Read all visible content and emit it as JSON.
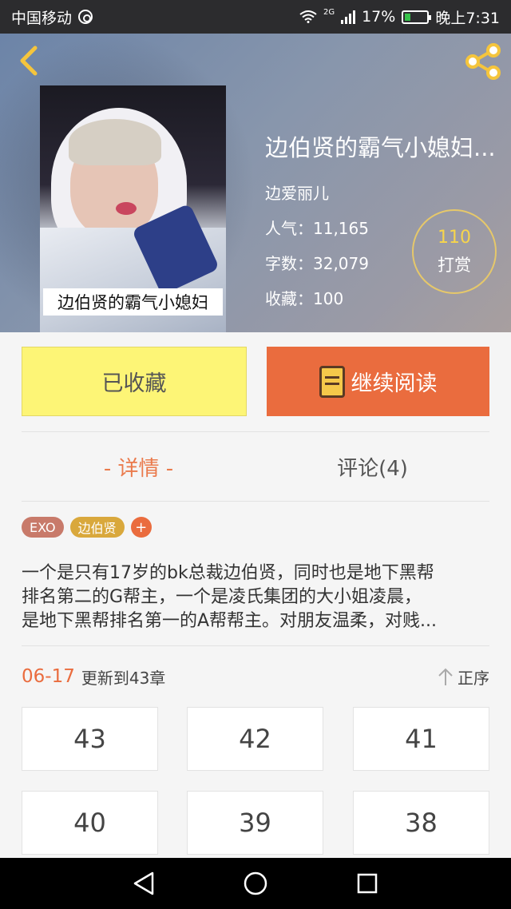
{
  "status_bar": {
    "carrier": "中国移动",
    "network": "2G",
    "battery": "17%",
    "time": "晚上7:31"
  },
  "book": {
    "cover_caption": "边伯贤的霸气小媳妇",
    "title": "边伯贤的霸气小媳妇...",
    "author": "边爱丽儿",
    "popularity": "人气：11,165",
    "word_count": "字数：32,079",
    "favorites": "收藏：100"
  },
  "reward": {
    "count": "110",
    "label": "打赏"
  },
  "buttons": {
    "collected": "已收藏",
    "continue_reading": "继续阅读"
  },
  "tabs": {
    "detail": "- 详情 -",
    "comments": "评论(4)"
  },
  "tags": [
    "EXO",
    "边伯贤",
    "+"
  ],
  "synopsis": {
    "line1": "一个是只有17岁的bk总裁边伯贤，同时也是地下黑帮",
    "line2": "排名第二的G帮主，一个是凌氏集团的大小姐凌晨，",
    "line3": "是地下黑帮排名第一的A帮帮主。对朋友温柔，对贱..."
  },
  "update": {
    "date": "06-17",
    "text": "更新到43章",
    "sort_label": "正序"
  },
  "chapters": [
    "43",
    "42",
    "41",
    "40",
    "39",
    "38"
  ],
  "colors": {
    "accent": "#ea6c3e",
    "collected_bg": "#fdf576",
    "reward_count": "#f7d54b"
  }
}
